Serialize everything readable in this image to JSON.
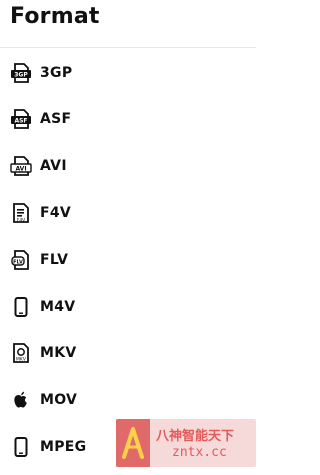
{
  "header": {
    "title": "Format"
  },
  "formats": [
    {
      "label": "3GP",
      "icon": "3gp-file-icon"
    },
    {
      "label": "ASF",
      "icon": "asf-file-icon"
    },
    {
      "label": "AVI",
      "icon": "avi-file-icon"
    },
    {
      "label": "F4V",
      "icon": "f4v-file-icon"
    },
    {
      "label": "FLV",
      "icon": "flv-file-icon"
    },
    {
      "label": "M4V",
      "icon": "mobile-phone-icon"
    },
    {
      "label": "MKV",
      "icon": "mkv-file-icon"
    },
    {
      "label": "MOV",
      "icon": "apple-icon"
    },
    {
      "label": "MPEG",
      "icon": "mobile-phone-icon"
    }
  ],
  "watermark": {
    "line1": "八神智能天下",
    "line2": "zntx.cc"
  }
}
